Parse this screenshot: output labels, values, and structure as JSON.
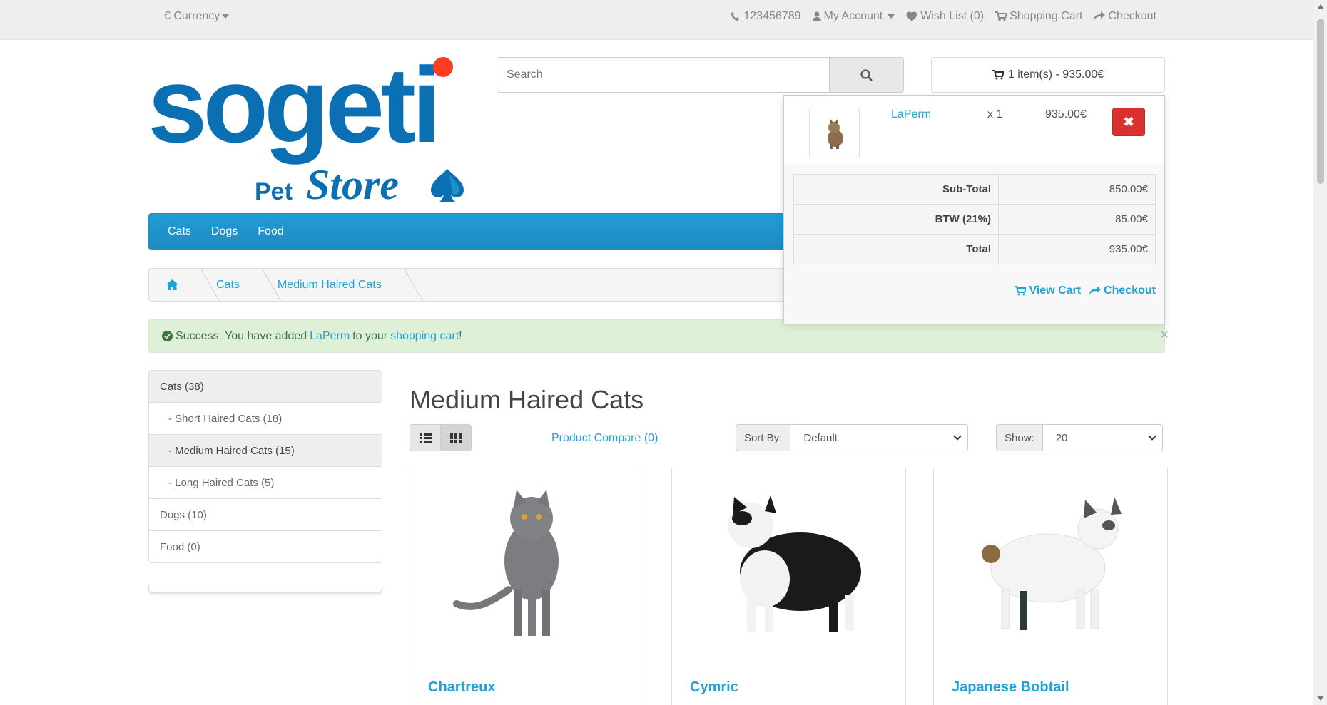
{
  "topbar": {
    "currency": "€ Currency",
    "phone": "123456789",
    "account": "My Account",
    "wishlist": "Wish List (0)",
    "cart": "Shopping Cart",
    "checkout": "Checkout"
  },
  "logo": {
    "word": "sogeti",
    "pet": "Pet",
    "store": "Store"
  },
  "search": {
    "placeholder": "Search"
  },
  "cart": {
    "summary": "1 item(s) - 935.00€",
    "item_name": "LaPerm",
    "item_qty": "x 1",
    "item_price": "935.00€",
    "remove": "✖",
    "totals": [
      {
        "label": "Sub-Total",
        "value": "850.00€"
      },
      {
        "label": "BTW (21%)",
        "value": "85.00€"
      },
      {
        "label": "Total",
        "value": "935.00€"
      }
    ],
    "view_cart": "View Cart",
    "checkout": "Checkout"
  },
  "nav": {
    "items": [
      "Cats",
      "Dogs",
      "Food"
    ]
  },
  "breadcrumb": {
    "items": [
      "Cats",
      "Medium Haired Cats"
    ]
  },
  "alert": {
    "prefix": "Success: You have added",
    "product": "LaPerm",
    "middle": "to your",
    "link": "shopping cart",
    "suffix": "!",
    "close": "×"
  },
  "sidebar": {
    "items": [
      "Cats (38)",
      "- Short Haired Cats (18)",
      "- Medium Haired Cats (15)",
      "- Long Haired Cats (5)",
      "Dogs (10)",
      "Food (0)"
    ]
  },
  "main": {
    "title": "Medium Haired Cats",
    "compare": "Product Compare (0)",
    "sort_label": "Sort By:",
    "sort_value": "Default",
    "show_label": "Show:",
    "show_value": "20"
  },
  "products": [
    "Chartreux",
    "Cymric",
    "Japanese Bobtail"
  ],
  "colors": {
    "brand": "#0a70b3",
    "accent": "#23a1d1",
    "nav": "#229ad4",
    "success_bg": "#dff0d8",
    "danger": "#d9312f"
  }
}
